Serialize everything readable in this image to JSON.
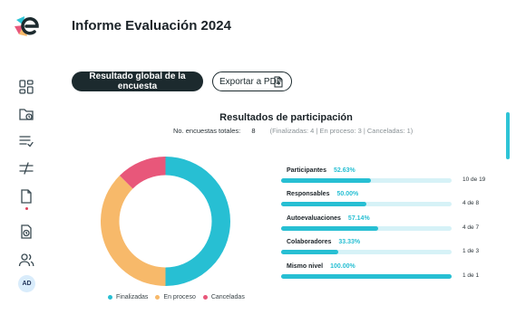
{
  "header": {
    "title": "Informe Evaluación 2024"
  },
  "toolbar": {
    "primary_label": "Resultado global de la encuesta",
    "export_label": "Exportar a PDF"
  },
  "sidebar": {
    "items": [
      {
        "icon": "dashboard-icon"
      },
      {
        "icon": "folder-clock-icon"
      },
      {
        "icon": "checklist-icon"
      },
      {
        "icon": "compare-arrows-icon"
      },
      {
        "icon": "document-icon",
        "has_indicator": true
      },
      {
        "icon": "clock-history-icon"
      },
      {
        "icon": "users-icon"
      }
    ],
    "avatar_initials": "AD"
  },
  "participation": {
    "title": "Resultados de participación",
    "total_label": "No. encuestas totales:",
    "total_value": "8",
    "detail": "(Finalizadas: 4 | En proceso: 3 | Canceladas: 1)"
  },
  "chart_data": {
    "type": "pie",
    "variant": "donut",
    "categories": [
      "Finalizadas",
      "En proceso",
      "Canceladas"
    ],
    "values": [
      4,
      3,
      1
    ],
    "colors": [
      "#27bfd3",
      "#f7b96a",
      "#e8577a"
    ]
  },
  "metrics": [
    {
      "label": "Participantes",
      "percent_text": "52.63%",
      "value": 0.5263,
      "count": "10 de 19"
    },
    {
      "label": "Responsables",
      "percent_text": "50.00%",
      "value": 0.5,
      "count": "4 de 8"
    },
    {
      "label": "Autoevaluaciones",
      "percent_text": "57.14%",
      "value": 0.5714,
      "count": "4 de 7"
    },
    {
      "label": "Colaboradores",
      "percent_text": "33.33%",
      "value": 0.3333,
      "count": "1 de 3"
    },
    {
      "label": "Mismo nivel",
      "percent_text": "100.00%",
      "value": 1.0,
      "count": "1 de 1"
    }
  ],
  "colors": {
    "accent": "#27bfd3",
    "track": "#d6f2f7",
    "dark": "#1c2a2e"
  }
}
